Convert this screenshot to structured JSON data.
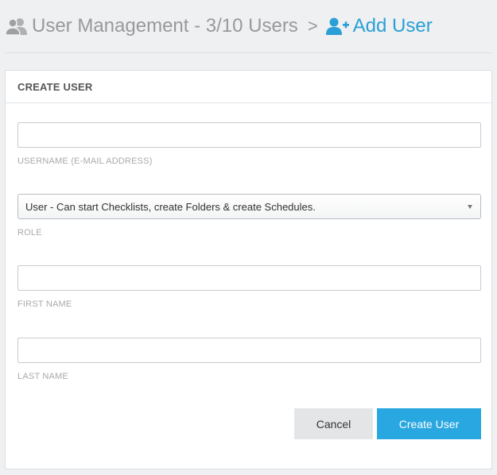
{
  "breadcrumb": {
    "parent_label": "User Management - 3/10 Users",
    "separator": ">",
    "current_label": "Add User",
    "parent_icon": "users-icon",
    "current_icon": "user-plus-icon"
  },
  "panel": {
    "title": "CREATE USER"
  },
  "form": {
    "username": {
      "label": "USERNAME (E-MAIL ADDRESS)",
      "value": ""
    },
    "role": {
      "label": "ROLE",
      "selected": "User - Can start Checklists, create Folders & create Schedules."
    },
    "first_name": {
      "label": "FIRST NAME",
      "value": ""
    },
    "last_name": {
      "label": "LAST NAME",
      "value": ""
    }
  },
  "actions": {
    "cancel_label": "Cancel",
    "submit_label": "Create User"
  },
  "colors": {
    "accent": "#2a9fd6",
    "primary_button": "#29a7e1",
    "secondary_button": "#e4e5e6",
    "muted_text": "#999999"
  }
}
